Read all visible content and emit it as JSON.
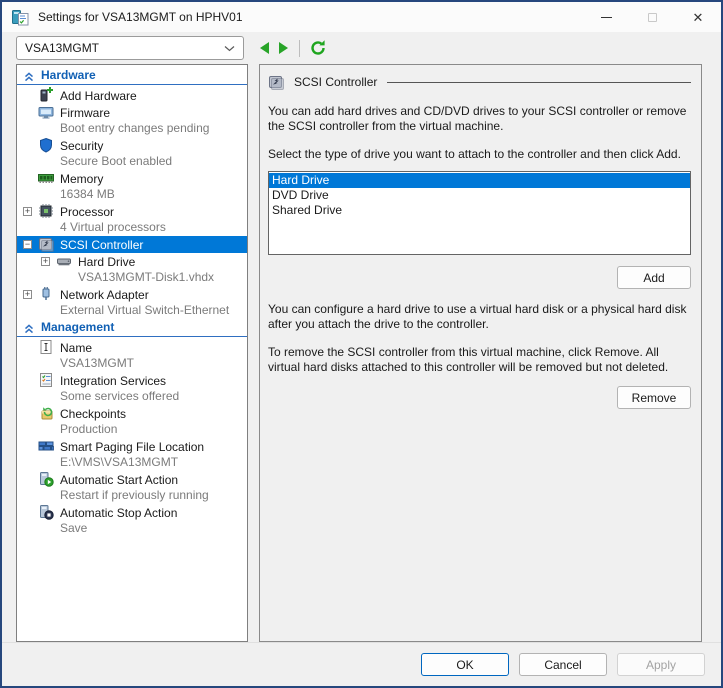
{
  "window": {
    "title": "Settings for VSA13MGMT on HPHV01",
    "icon": "vm-settings-icon"
  },
  "toolbar": {
    "vm_selector_value": "VSA13MGMT",
    "nav": [
      "back",
      "forward",
      "refresh"
    ]
  },
  "sidebar": {
    "sections": [
      {
        "label": "Hardware",
        "items": [
          {
            "label": "Add Hardware",
            "icon": "add-hardware-icon"
          },
          {
            "label": "Firmware",
            "sub": "Boot entry changes pending",
            "icon": "firmware-icon"
          },
          {
            "label": "Security",
            "sub": "Secure Boot enabled",
            "icon": "security-icon"
          },
          {
            "label": "Memory",
            "sub": "16384 MB",
            "icon": "memory-icon"
          },
          {
            "label": "Processor",
            "sub": "4 Virtual processors",
            "icon": "processor-icon",
            "expander": "+"
          },
          {
            "label": "SCSI Controller",
            "icon": "scsi-controller-icon",
            "expander": "-",
            "selected": true
          },
          {
            "label": "Hard Drive",
            "sub": "VSA13MGMT-Disk1.vhdx",
            "icon": "hard-drive-icon",
            "expander": "+",
            "level": 2
          },
          {
            "label": "Network Adapter",
            "sub": "External Virtual Switch-Ethernet",
            "icon": "network-adapter-icon",
            "expander": "+"
          }
        ]
      },
      {
        "label": "Management",
        "items": [
          {
            "label": "Name",
            "sub": "VSA13MGMT",
            "icon": "name-icon"
          },
          {
            "label": "Integration Services",
            "sub": "Some services offered",
            "icon": "integration-services-icon"
          },
          {
            "label": "Checkpoints",
            "sub": "Production",
            "icon": "checkpoints-icon"
          },
          {
            "label": "Smart Paging File Location",
            "sub": "E:\\VMS\\VSA13MGMT",
            "icon": "smart-paging-icon"
          },
          {
            "label": "Automatic Start Action",
            "sub": "Restart if previously running",
            "icon": "auto-start-icon"
          },
          {
            "label": "Automatic Stop Action",
            "sub": "Save",
            "icon": "auto-stop-icon"
          }
        ]
      }
    ]
  },
  "main": {
    "header": {
      "title": "SCSI Controller",
      "icon": "scsi-controller-icon"
    },
    "intro": "You can add hard drives and CD/DVD drives to your SCSI controller or remove the SCSI controller from the virtual machine.",
    "select_prompt": "Select the type of drive you want to attach to the controller and then click Add.",
    "drive_list": {
      "items": [
        {
          "label": "Hard Drive",
          "selected": true
        },
        {
          "label": "DVD Drive",
          "selected": false
        },
        {
          "label": "Shared Drive",
          "selected": false
        }
      ]
    },
    "add_button": "Add",
    "configure_note": "You can configure a hard drive to use a virtual hard disk or a physical hard disk after you attach the drive to the controller.",
    "remove_note": "To remove the SCSI controller from this virtual machine, click Remove. All virtual hard disks attached to this controller will be removed but not deleted.",
    "remove_button": "Remove"
  },
  "footer": {
    "ok": "OK",
    "cancel": "Cancel",
    "apply": "Apply",
    "apply_disabled": true
  },
  "colors": {
    "accent": "#0078d7",
    "section_header_blue": "#1160b4",
    "window_border": "#26477d",
    "nav_green": "#28a428",
    "subtext_gray": "#7b7b7b"
  }
}
